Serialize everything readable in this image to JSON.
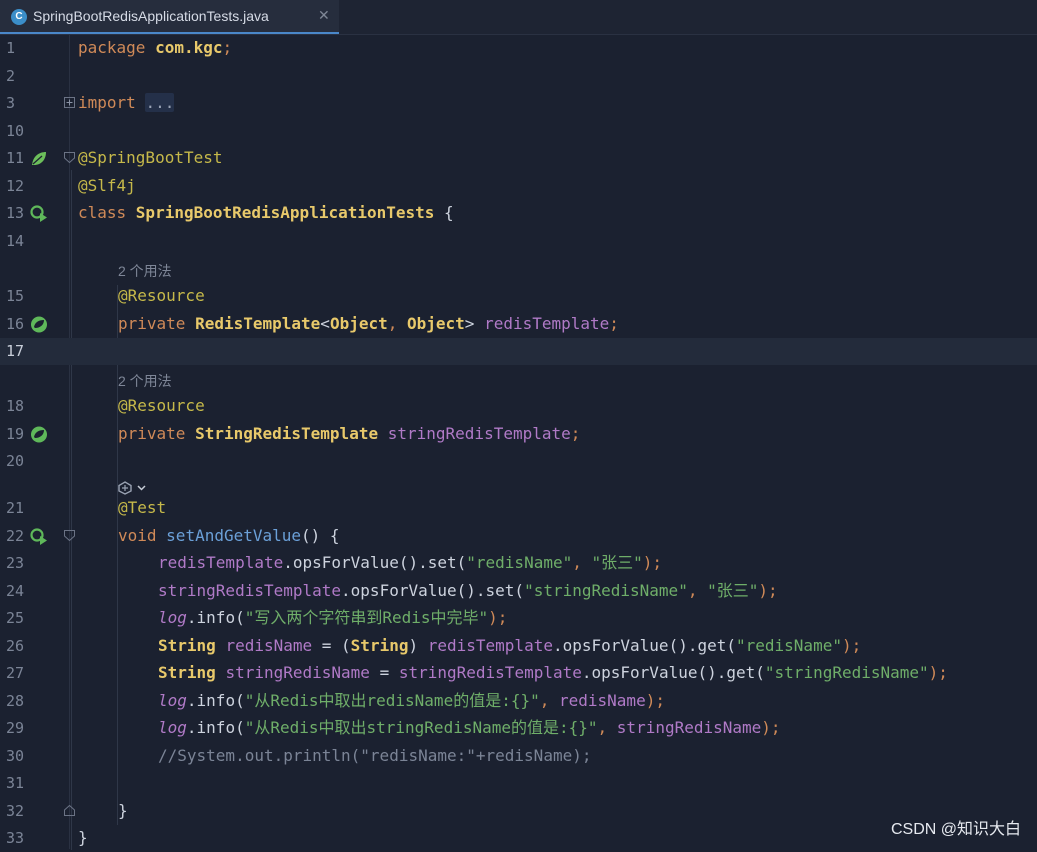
{
  "tab": {
    "title": "SpringBootRedisApplicationTests.java",
    "icon": "C",
    "close": "✕"
  },
  "lines": {
    "l1": {
      "num": "1",
      "kw": "package ",
      "rest": "com.kgc",
      "semi": ";"
    },
    "l2": {
      "num": "2"
    },
    "l3": {
      "num": "3",
      "kw": "import ",
      "folded": "..."
    },
    "l10": {
      "num": "10"
    },
    "l11": {
      "num": "11",
      "ann": "@SpringBootTest"
    },
    "l12": {
      "num": "12",
      "ann": "@Slf4j"
    },
    "l13": {
      "num": "13",
      "kw": "class ",
      "cls": "SpringBootRedisApplicationTests",
      "rest": " {"
    },
    "l14": {
      "num": "14"
    },
    "h1": {
      "text": "2 个用法"
    },
    "l15": {
      "num": "15",
      "ann": "@Resource"
    },
    "l16": {
      "num": "16",
      "kw": "private ",
      "cls": "RedisTemplate",
      "p1": "<",
      "t1": "Object",
      "p2": ", ",
      "t2": "Object",
      "p3": "> ",
      "field": "redisTemplate",
      "semi": ";"
    },
    "l17": {
      "num": "17"
    },
    "h2": {
      "text": "2 个用法"
    },
    "l18": {
      "num": "18",
      "ann": "@Resource"
    },
    "l19": {
      "num": "19",
      "kw": "private ",
      "cls": "StringRedisTemplate",
      "sp": " ",
      "field": "stringRedisTemplate",
      "semi": ";"
    },
    "l20": {
      "num": "20"
    },
    "l21": {
      "num": "21",
      "ann": "@Test"
    },
    "l22": {
      "num": "22",
      "kw": "void ",
      "fn": "setAndGetValue",
      "rest": "() {"
    },
    "l23": {
      "num": "23",
      "field": "redisTemplate",
      "m": ".opsForValue().set(",
      "s1": "\"redisName\"",
      "c": ", ",
      "s2": "\"张三\"",
      "e": ");"
    },
    "l24": {
      "num": "24",
      "field": "stringRedisTemplate",
      "m": ".opsForValue().set(",
      "s1": "\"stringRedisName\"",
      "c": ", ",
      "s2": "\"张三\"",
      "e": ");"
    },
    "l25": {
      "num": "25",
      "log": "log",
      "m": ".info(",
      "s1": "\"写入两个字符串到Redis中完毕\"",
      "e": ");"
    },
    "l26": {
      "num": "26",
      "cls": "String",
      "sp": " ",
      "field": "redisName",
      "eq": " = (",
      "cls2": "String",
      "cp": ") ",
      "field2": "redisTemplate",
      "m": ".opsForValue().get(",
      "s1": "\"redisName\"",
      "e": ");"
    },
    "l27": {
      "num": "27",
      "cls": "String",
      "sp": " ",
      "field": "stringRedisName",
      "eq": " = ",
      "field2": "stringRedisTemplate",
      "m": ".opsForValue().get(",
      "s1": "\"stringRedisName\"",
      "e": ");"
    },
    "l28": {
      "num": "28",
      "log": "log",
      "m": ".info(",
      "s1": "\"从Redis中取出redisName的值是:{}\"",
      "c": ", ",
      "field": "redisName",
      "e": ");"
    },
    "l29": {
      "num": "29",
      "log": "log",
      "m": ".info(",
      "s1": "\"从Redis中取出stringRedisName的值是:{}\"",
      "c": ", ",
      "field": "stringRedisName",
      "e": ");"
    },
    "l30": {
      "num": "30",
      "cmt": "//System.out.println(\"redisName:\"+redisName);"
    },
    "l31": {
      "num": "31"
    },
    "l32": {
      "num": "32",
      "rest": "}"
    },
    "l33": {
      "num": "33",
      "rest": "}"
    }
  },
  "watermark": "CSDN @知识大白",
  "colors": {
    "keyword": "#d08a58",
    "class": "#e8c96b",
    "annotation": "#c6b94a",
    "field": "#b07ac7",
    "string": "#6fae69",
    "method": "#6ba0d8",
    "comment": "#7b8496"
  }
}
